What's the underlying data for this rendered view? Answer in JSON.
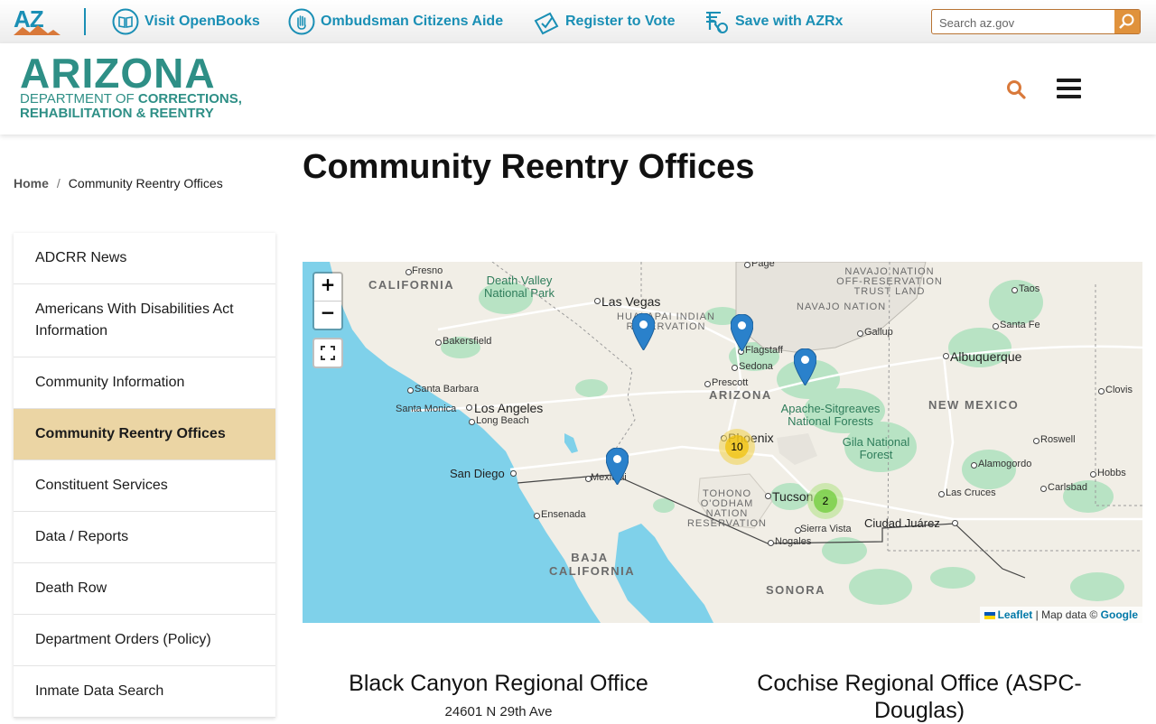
{
  "topbar": {
    "logo_text": "AZ",
    "links": [
      {
        "label": "Visit OpenBooks",
        "icon": "book-icon"
      },
      {
        "label": "Ombudsman Citizens Aide",
        "icon": "hand-icon"
      },
      {
        "label": "Register to Vote",
        "icon": "ballot-icon"
      },
      {
        "label": "Save with AZRx",
        "icon": "prescription-icon"
      }
    ],
    "search_placeholder": "Search az.gov"
  },
  "header": {
    "brand_big": "ARIZONA",
    "brand_line1_a": "DEPARTMENT OF ",
    "brand_line1_b": "CORRECTIONS,",
    "brand_line2": "REHABILITATION & REENTRY"
  },
  "breadcrumb": {
    "home": "Home",
    "separator": "/",
    "current": "Community Reentry Offices"
  },
  "page_title": "Community Reentry Offices",
  "sidenav": [
    "ADCRR News",
    "Americans With Disabilities Act Information",
    "Community Information",
    "Community Reentry Offices",
    "Constituent Services",
    "Data / Reports",
    "Death Row",
    "Department Orders (Policy)",
    "Inmate Data Search"
  ],
  "sidenav_active_index": 3,
  "map": {
    "zoom_in": "+",
    "zoom_out": "−",
    "regions": [
      "CALIFORNIA",
      "ARIZONA",
      "NEW MEXICO",
      "BAJA CALIFORNIA",
      "SONORA"
    ],
    "reservations": [
      "NAVAJO NATION OFF-RESERVATION TRUST LAND",
      "NAVAJO NATION",
      "HUALAPAI INDIAN RESERVATION",
      "TOHONO O'ODHAM NATION RESERVATION"
    ],
    "parks": [
      "Death Valley National Park",
      "Apache-Sitgreaves National Forests",
      "Gila National Forest"
    ],
    "cities_major": [
      "Las Vegas",
      "Los Angeles",
      "San Diego",
      "Phoenix",
      "Tucson",
      "Albuquerque",
      "Ciudad Juárez"
    ],
    "cities_minor": [
      "Fresno",
      "Page",
      "Taos",
      "Bakersfield",
      "Santa Fe",
      "Gallup",
      "Flagstaff",
      "Sedona",
      "Prescott",
      "Santa Barbara",
      "Santa Monica",
      "Long Beach",
      "Clovis",
      "Roswell",
      "Mexicali",
      "Alamogordo",
      "Hobbs",
      "Ensenada",
      "Las Cruces",
      "Carlsbad",
      "Sierra Vista",
      "Nogales"
    ],
    "clusters": [
      {
        "count": "10",
        "color": "#f1d357"
      },
      {
        "count": "2",
        "color": "#6ecc39"
      }
    ],
    "attribution": {
      "leaflet": "Leaflet",
      "sep": "|",
      "text": "Map data ©",
      "google": "Google"
    }
  },
  "offices": [
    {
      "name": "Black Canyon Regional Office",
      "address": "24601 N 29th Ave"
    },
    {
      "name": "Cochise Regional Office (ASPC-Douglas)",
      "address": ""
    }
  ],
  "colors": {
    "teal": "#2e8f86",
    "link_blue": "#1a8fb5",
    "active_nav": "#ebd5a4",
    "water": "#7fd1ea",
    "marker": "#2a81cb"
  }
}
